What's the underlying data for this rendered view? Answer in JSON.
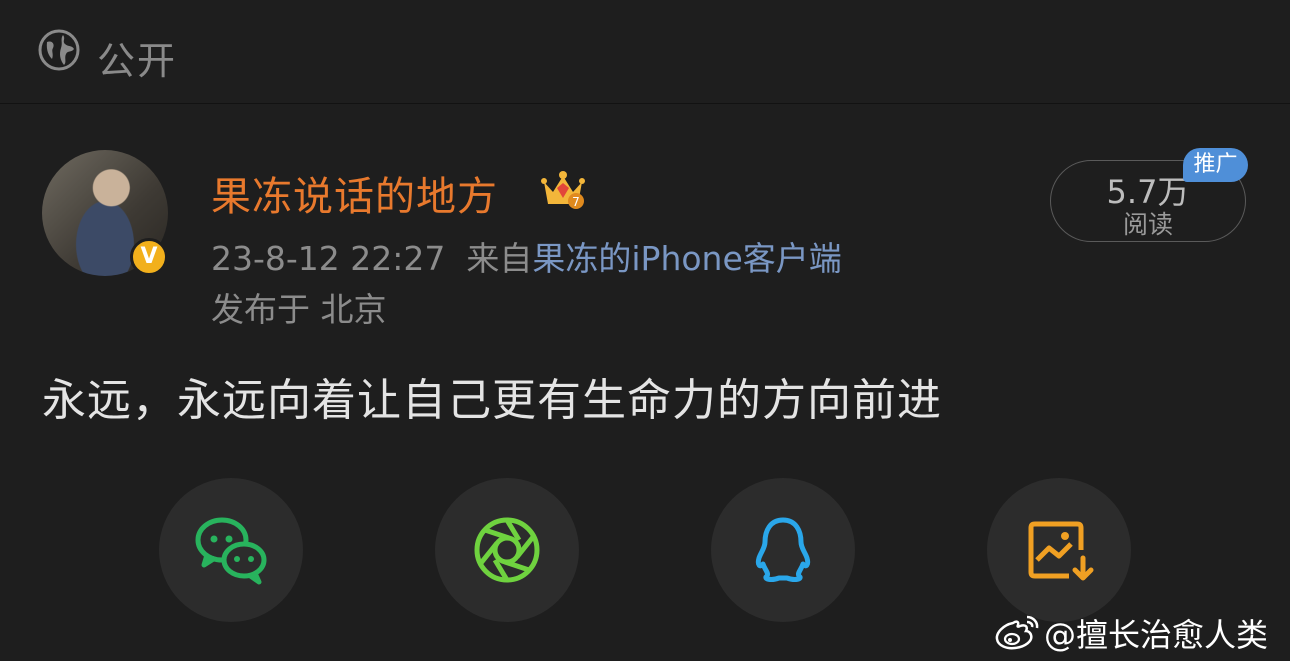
{
  "header": {
    "visibility_label": "公开",
    "icon": "globe-icon"
  },
  "post": {
    "author": "果冻说话的地方",
    "verified_badge": "V",
    "timestamp": "23-8-12 22:27",
    "source_prefix": "来自",
    "source": "果冻的iPhone客户端",
    "location": "发布于 北京",
    "content": "永远，永远向着让自己更有生命力的方向前进",
    "reads": {
      "value": "5.7万",
      "label": "阅读"
    },
    "promo_label": "推广"
  },
  "share_buttons": [
    {
      "name": "wechat",
      "icon": "wechat-icon",
      "color": "#28b35d"
    },
    {
      "name": "moments",
      "icon": "moments-icon",
      "color": "#6fd23f"
    },
    {
      "name": "qq",
      "icon": "qq-icon",
      "color": "#2aa7ea"
    },
    {
      "name": "save-image",
      "icon": "save-image-icon",
      "color": "#f0a023"
    }
  ],
  "watermark": {
    "text": "@擅长治愈人类",
    "icon": "weibo-icon"
  }
}
